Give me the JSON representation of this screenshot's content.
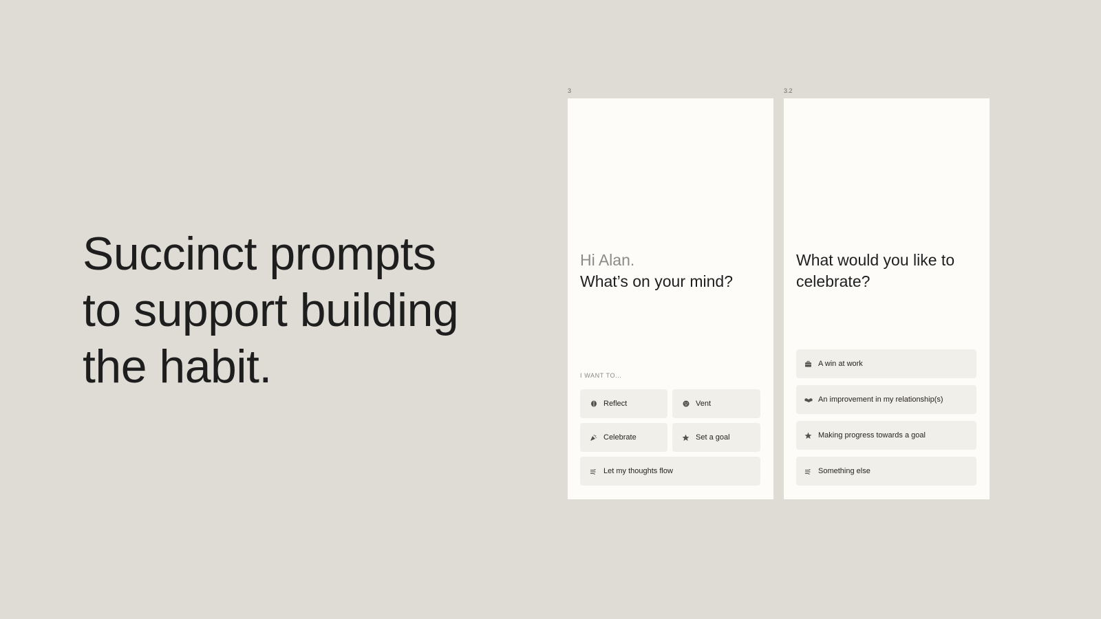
{
  "headline": {
    "line1": "Succinct prompts",
    "line2": "to support building",
    "line3": "the habit."
  },
  "frames": {
    "first_label": "3",
    "second_label": "3.2"
  },
  "screen1": {
    "greeting": "Hi Alan.",
    "question": "What’s on your mind?",
    "section_label": "I WANT TO...",
    "options": {
      "reflect": {
        "label": "Reflect",
        "icon": "brain-icon"
      },
      "vent": {
        "label": "Vent",
        "icon": "face-icon"
      },
      "celebrate": {
        "label": "Celebrate",
        "icon": "party-icon"
      },
      "set_goal": {
        "label": "Set a goal",
        "icon": "star-icon"
      },
      "flow": {
        "label": "Let my thoughts flow",
        "icon": "thoughts-icon"
      }
    }
  },
  "screen2": {
    "question": "What would you like to celebrate?",
    "options": {
      "work": {
        "label": "A win at work",
        "icon": "briefcase-icon"
      },
      "relationship": {
        "label": "An improvement in my relationship(s)",
        "icon": "handshake-icon"
      },
      "goal": {
        "label": "Making progress towards a goal",
        "icon": "star-icon"
      },
      "else": {
        "label": "Something else",
        "icon": "thoughts-icon"
      }
    }
  },
  "colors": {
    "background": "#dfdcd5",
    "screen": "#fdfcf9",
    "option": "#f1efe9",
    "muted_text": "#8d8b86"
  }
}
